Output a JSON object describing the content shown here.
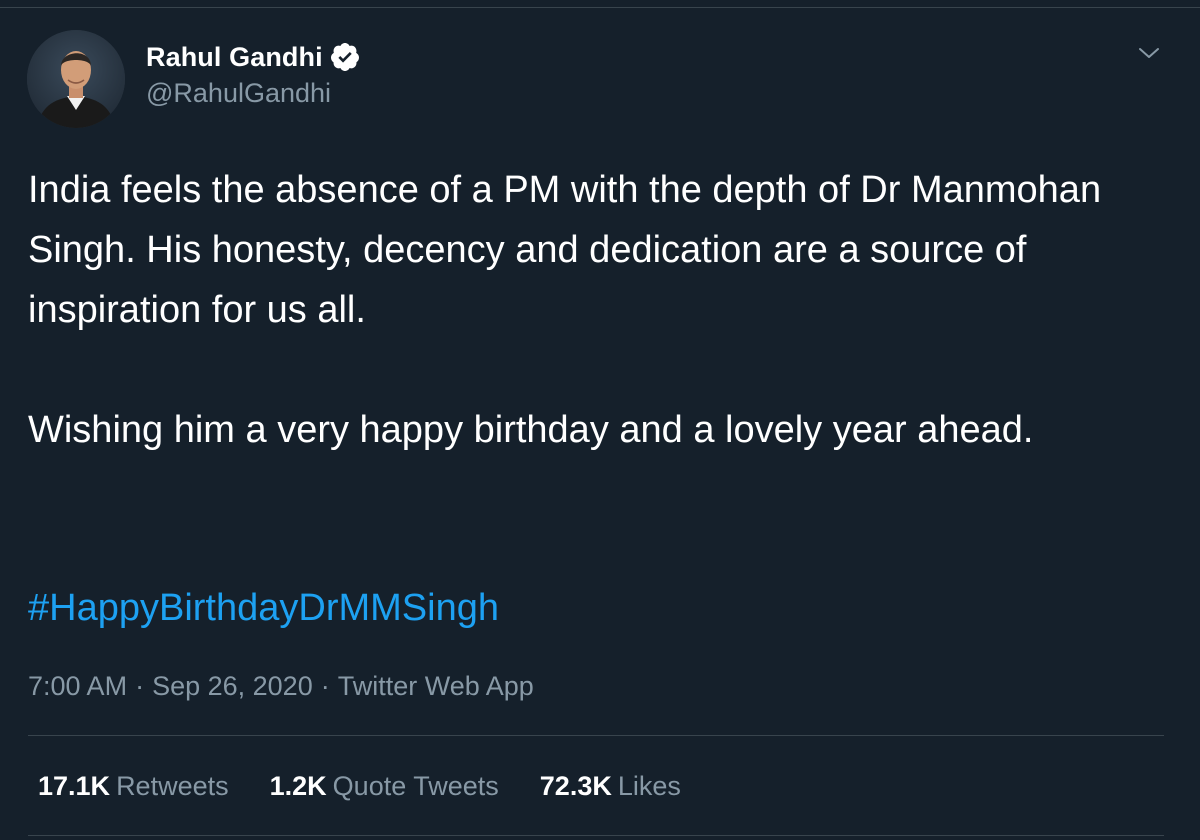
{
  "author": {
    "name": "Rahul Gandhi",
    "handle": "@RahulGandhi"
  },
  "tweet": {
    "paragraphs": [
      "India feels the absence of a PM with the depth of Dr Manmohan Singh. His honesty, decency and dedication are a source of inspiration for us all.",
      "Wishing him a very happy birthday and a lovely year ahead."
    ],
    "hashtag": "#HappyBirthdayDrMMSingh"
  },
  "meta": {
    "time": "7:00 AM",
    "date": "Sep 26, 2020",
    "source": "Twitter Web App",
    "separator": "·"
  },
  "stats": [
    {
      "count": "17.1K",
      "label": "Retweets"
    },
    {
      "count": "1.2K",
      "label": "Quote Tweets"
    },
    {
      "count": "72.3K",
      "label": "Likes"
    }
  ],
  "colors": {
    "background": "#15202b",
    "text": "#ffffff",
    "secondary": "#8899a6",
    "accent": "#1da1f2",
    "border": "#38444d"
  },
  "icons": {
    "verified": "verified-badge-icon",
    "menu": "chevron-down-icon"
  }
}
